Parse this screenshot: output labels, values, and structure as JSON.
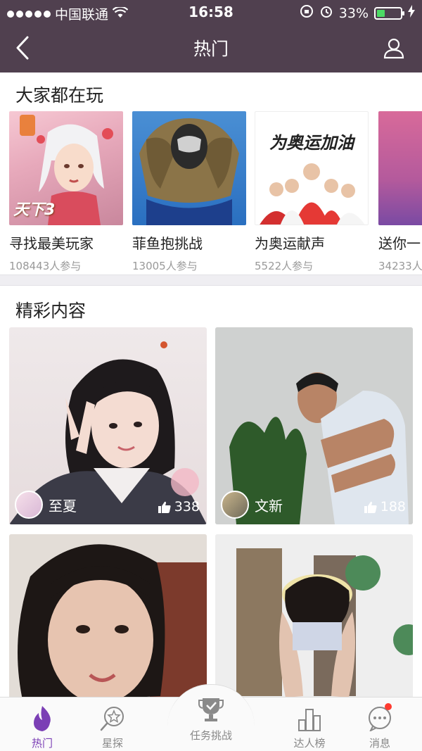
{
  "status_bar": {
    "carrier": "中国联通",
    "time": "16:58",
    "battery": "33%",
    "battery_level": 0.33
  },
  "nav": {
    "title": "热门",
    "back_icon": "chevron-left-icon",
    "profile_icon": "user-icon"
  },
  "popular": {
    "title": "大家都在玩",
    "items": [
      {
        "name": "寻找最美玩家",
        "count": "108443人参与",
        "image_text": "天下3"
      },
      {
        "name": "菲鱼抱挑战",
        "count": "13005人参与"
      },
      {
        "name": "为奥运献声",
        "count": "5522人参与",
        "image_text": "为奥运加油"
      },
      {
        "name": "送你一",
        "count": "34233人"
      }
    ]
  },
  "featured": {
    "title": "精彩内容",
    "cards": [
      {
        "author": "至夏",
        "likes": "338"
      },
      {
        "author": "文新",
        "likes": "188"
      },
      {
        "author": "",
        "likes": ""
      },
      {
        "author": "",
        "likes": ""
      }
    ]
  },
  "tabbar": {
    "tabs": [
      {
        "label": "热门",
        "icon": "flame-icon",
        "active": true
      },
      {
        "label": "星探",
        "icon": "star-search-icon"
      },
      {
        "label": "任务挑战",
        "icon": "trophy-icon"
      },
      {
        "label": "达人榜",
        "icon": "bar-chart-icon"
      },
      {
        "label": "消息",
        "icon": "message-icon",
        "badge": true
      }
    ]
  },
  "colors": {
    "header": "#50404f",
    "accent": "#7b3fb5",
    "battery": "#4cd964",
    "badge": "#ff3b30"
  }
}
